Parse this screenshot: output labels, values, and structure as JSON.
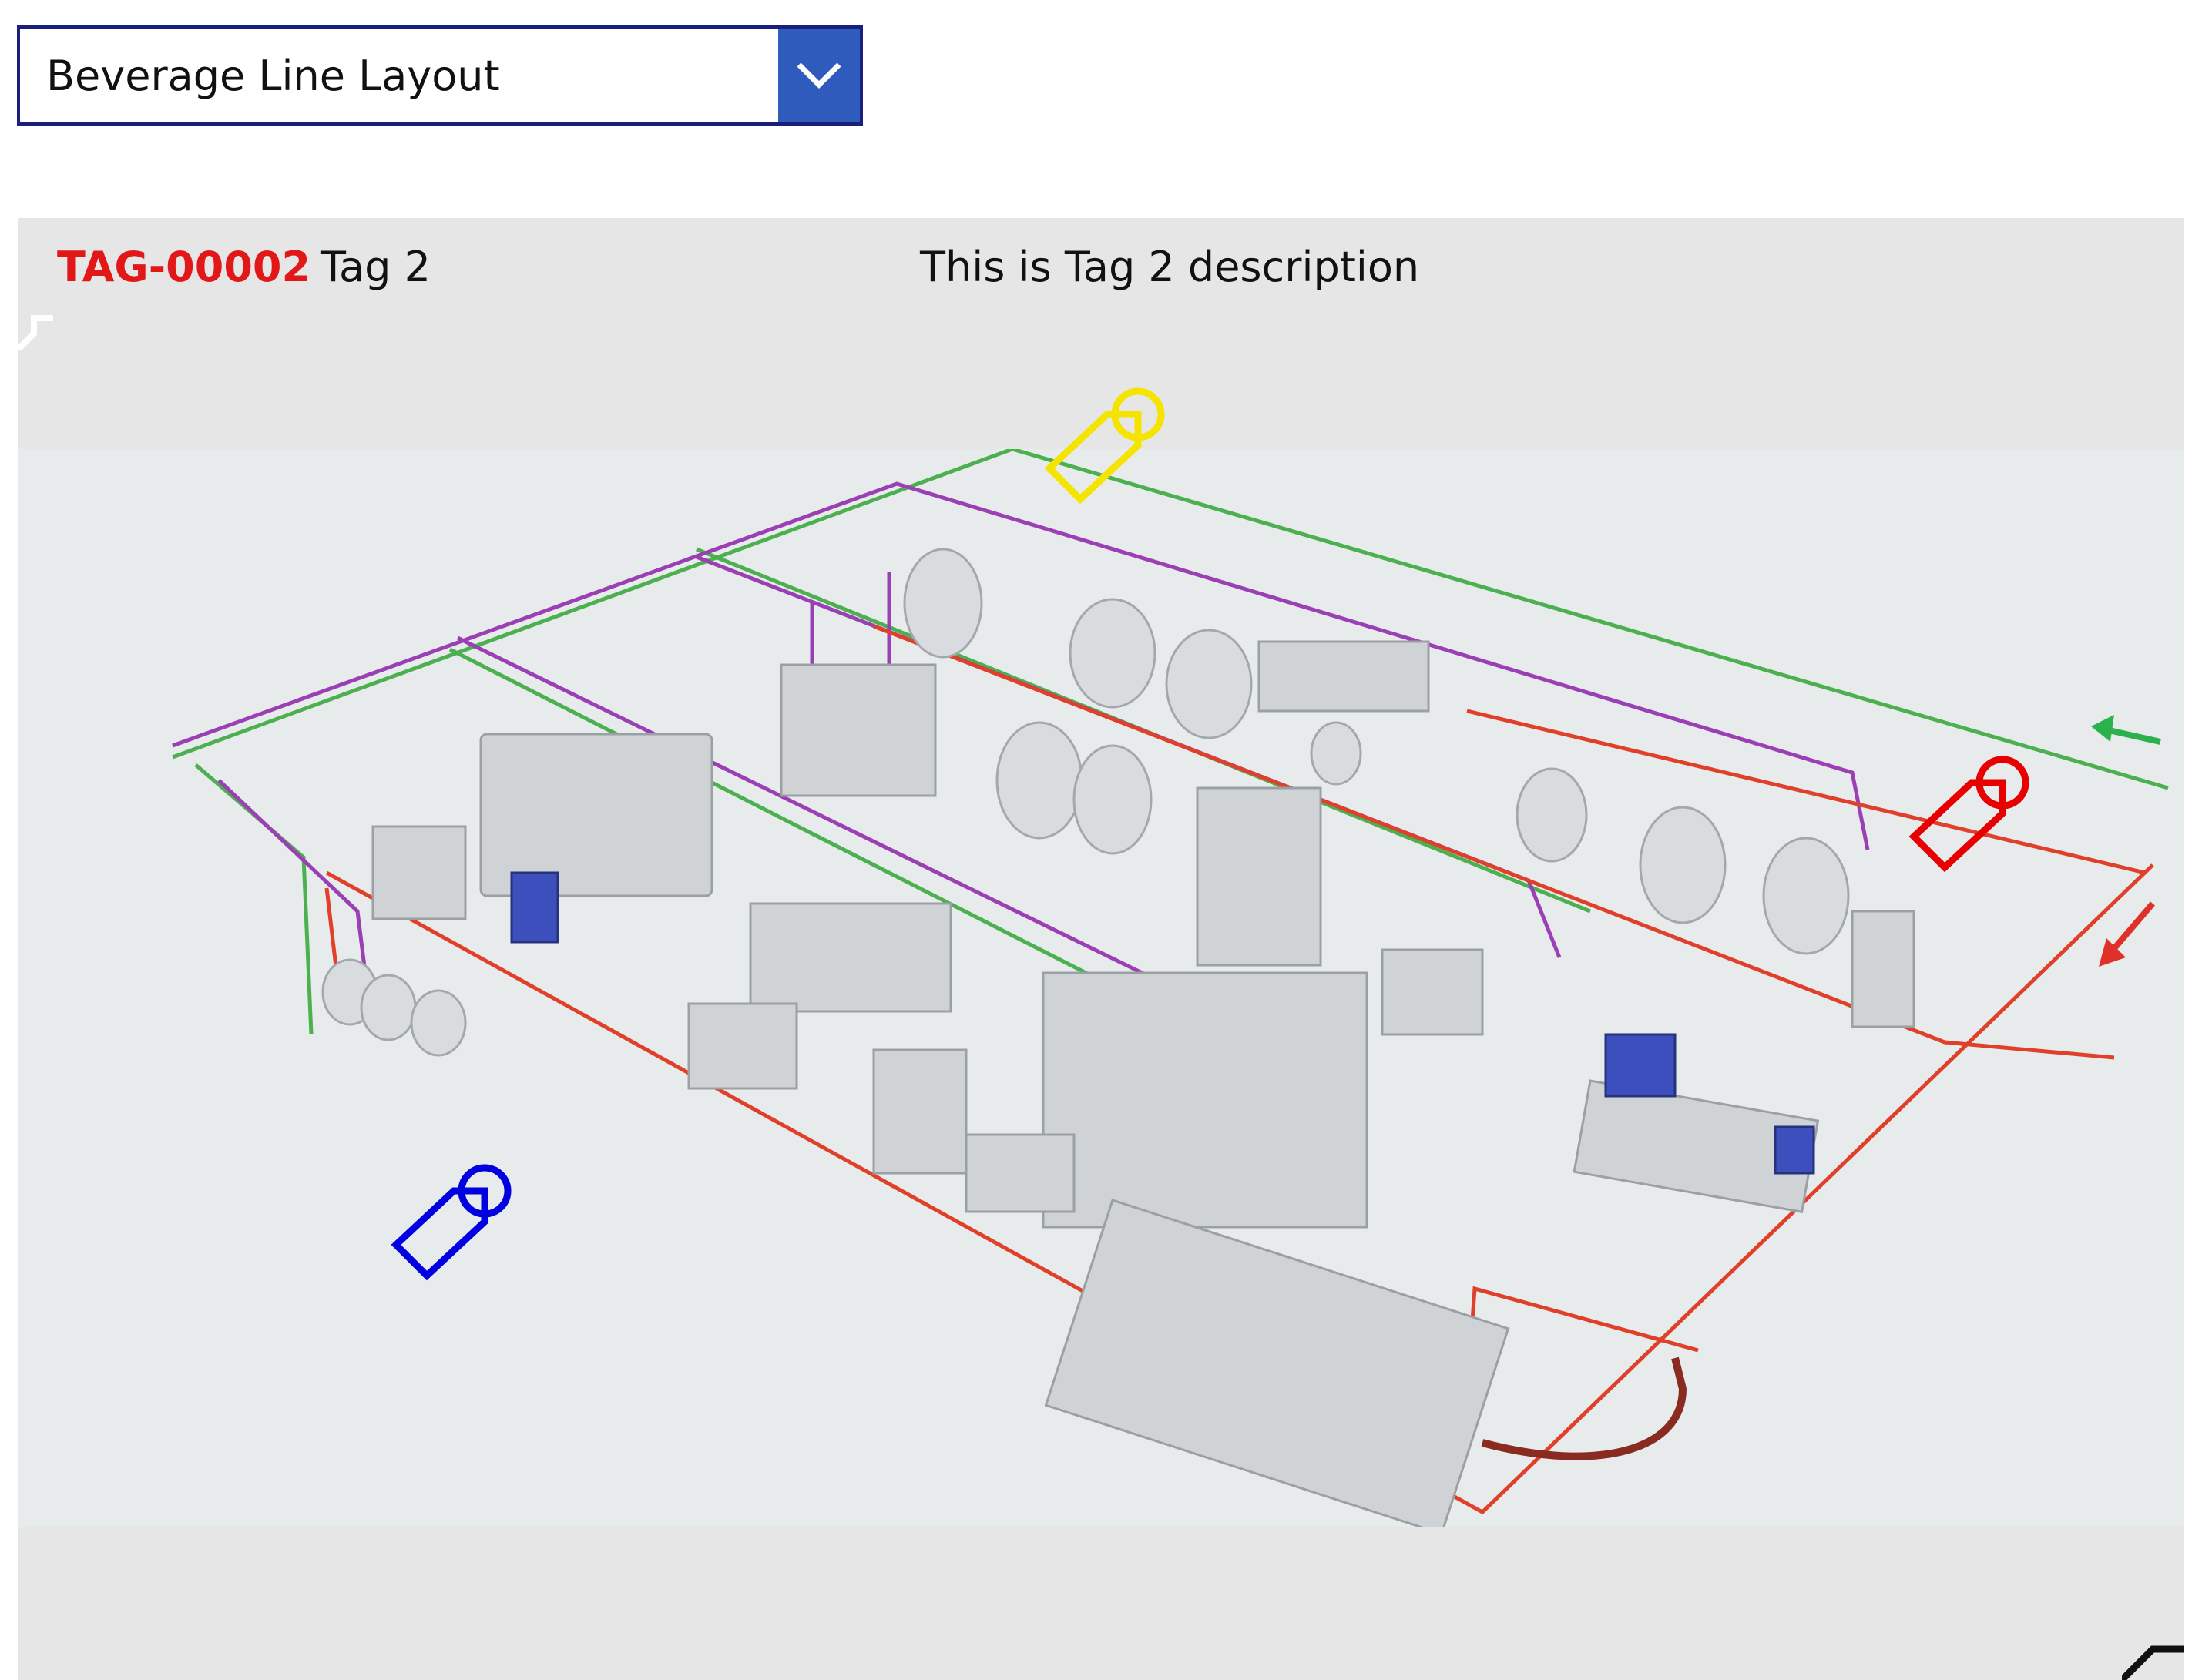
{
  "dropdown": {
    "selected_value": "Beverage Line Layout",
    "chevron_icon": "chevron-down-icon"
  },
  "tag_panel": {
    "tag_id": "TAG-00002",
    "tag_name": "Tag 2",
    "tag_description": "This is Tag 2 description"
  },
  "tag_markers": [
    {
      "name": "tag-marker-yellow",
      "color": "#f5e400",
      "icon": "tag-icon"
    },
    {
      "name": "tag-marker-red",
      "color": "#e80000",
      "icon": "tag-icon"
    },
    {
      "name": "tag-marker-blue",
      "color": "#0000e0",
      "icon": "tag-icon"
    }
  ],
  "colors": {
    "accent_blue": "#2f5bbd",
    "border_navy": "#1a1f7a",
    "tag_id_red": "#e21818",
    "pipe_green": "#4caf50",
    "pipe_purple": "#9b3fb5",
    "pipe_red": "#e0402a"
  }
}
